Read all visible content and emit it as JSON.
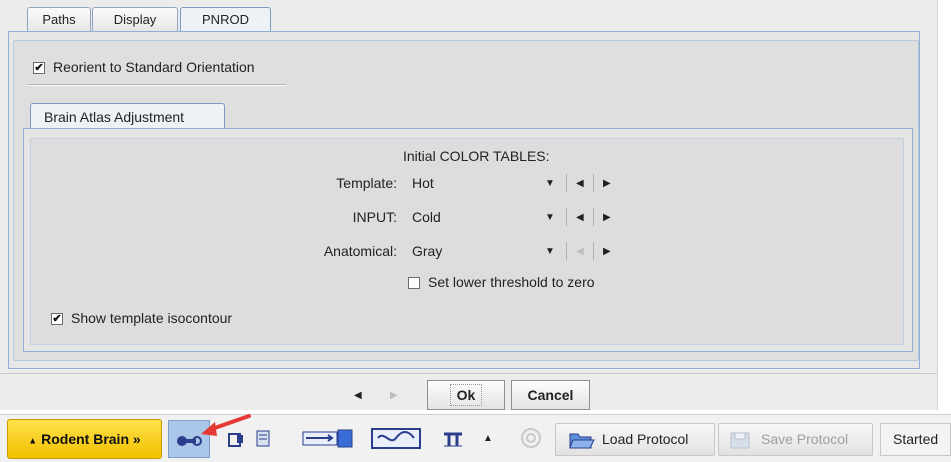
{
  "tabs": [
    {
      "label": "Paths",
      "active": false
    },
    {
      "label": "Display",
      "active": false
    },
    {
      "label": "PNROD",
      "active": true
    }
  ],
  "reorient": {
    "label": "Reorient to Standard Orientation",
    "checked": true
  },
  "subtab": {
    "label": "Brain Atlas Adjustment"
  },
  "color_tables": {
    "heading": "Initial COLOR TABLES:",
    "rows": [
      {
        "label": "Template:",
        "value": "Hot",
        "prev_enabled": true,
        "next_enabled": true
      },
      {
        "label": "INPUT:",
        "value": "Cold",
        "prev_enabled": true,
        "next_enabled": true
      },
      {
        "label": "Anatomical:",
        "value": "Gray",
        "prev_enabled": false,
        "next_enabled": true
      }
    ]
  },
  "lower_threshold": {
    "label": "Set lower threshold to zero",
    "checked": false
  },
  "isocontour": {
    "label": "Show template isocontour",
    "checked": true
  },
  "footer": {
    "ok_label": "Ok",
    "cancel_label": "Cancel"
  },
  "statusbar": {
    "module_label": "Rodent Brain »",
    "load_protocol_label": "Load Protocol",
    "save_protocol_label": "Save Protocol",
    "status_text": "Started"
  },
  "icons": {
    "check": "✔",
    "combo_arrow": "▼",
    "prev": "◀",
    "next": "▶",
    "up_arrow": "▲"
  },
  "colors": {
    "module_button": "#f2c100",
    "selected_tool": "#aac6e8",
    "annotation_arrow": "#e53935"
  }
}
